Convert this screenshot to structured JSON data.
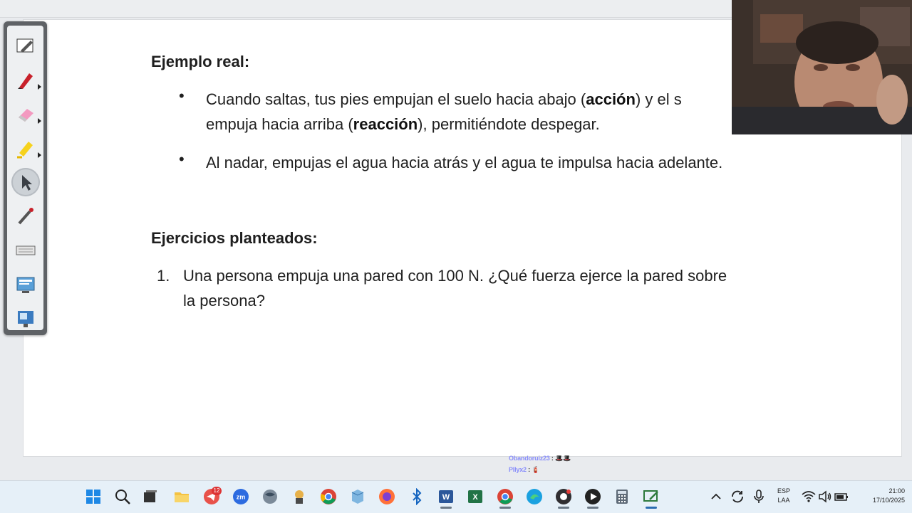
{
  "slide": {
    "heading1": "Ejemplo real:",
    "bullet1_line1_a": "Cuando saltas, tus pies empujan el suelo hacia abajo (",
    "bullet1_line1_bold": "acción",
    "bullet1_line1_b": ") y el s",
    "bullet1_line2_a": "empuja hacia arriba (",
    "bullet1_line2_bold": "reacción",
    "bullet1_line2_b": "), permitiéndote despegar.",
    "bullet2": "Al nadar, empujas el agua hacia atrás y el agua te impulsa hacia adelante.",
    "bullet_symbol": "•",
    "heading2": "Ejercicios planteados:",
    "item1_number": "1.",
    "item1_line1": "Una persona empuja una pared con 100 N. ¿Qué fuerza ejerce la pared sobre",
    "item1_line2": "la persona?"
  },
  "toolbar": {
    "tools": [
      "pen-icon",
      "red-marker-icon",
      "eraser-icon",
      "highlighter-icon",
      "pointer-icon",
      "laser-pen-icon",
      "keyboard-icon",
      "screen-capture-icon",
      "presentation-icon"
    ]
  },
  "chat": {
    "line1_user": "Obandoruiz23",
    "line1_sep": " : ",
    "line1_emoji": "🎩🎩",
    "line2_user": "Pllyx2",
    "line2_sep": " : ",
    "line2_emoji": "🧯"
  },
  "taskbar": {
    "telegram_badge": "12",
    "zoom_label": "zm",
    "language": "ESP",
    "layout": "LAA",
    "time": "21:00",
    "date": "17/10/2025"
  }
}
